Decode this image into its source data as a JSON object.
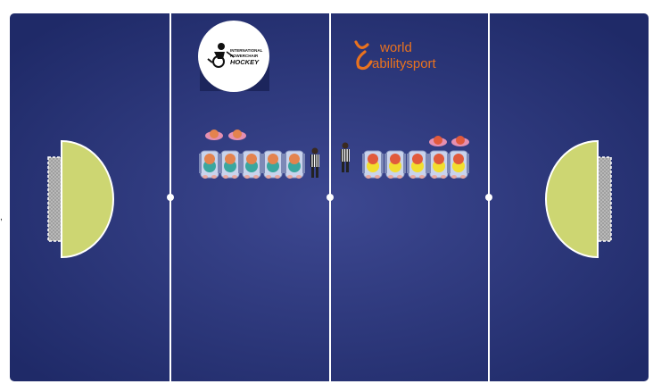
{
  "colors": {
    "floor_center": "#39438c",
    "floor_edge": "#1f2a68",
    "lines": "#ffffff",
    "goal_area": "#cdd672",
    "team_left_helmet": "#e4834e",
    "team_left_shirt": "#3aa79f",
    "team_right_helmet": "#e15a3c",
    "team_right_shirt": "#f2de2f",
    "wheelchair": "#c9d3ec",
    "referee_stripes": "#1a1a1a"
  },
  "logos": {
    "powerchair_hockey": {
      "icon": "wheelchair-hockey-player-icon",
      "lines": [
        "INTERNATIONAL",
        "POWERCHAIR",
        "HOCKEY"
      ]
    },
    "world_ability_sport": {
      "icon": "world-ability-sport-mark-icon",
      "line1": "world",
      "line2": "abilitysport",
      "color": "#e9721e"
    }
  },
  "teams": {
    "left": {
      "players": 5,
      "substitutes": 2
    },
    "right": {
      "players": 5,
      "substitutes": 2
    }
  },
  "referees": 2
}
